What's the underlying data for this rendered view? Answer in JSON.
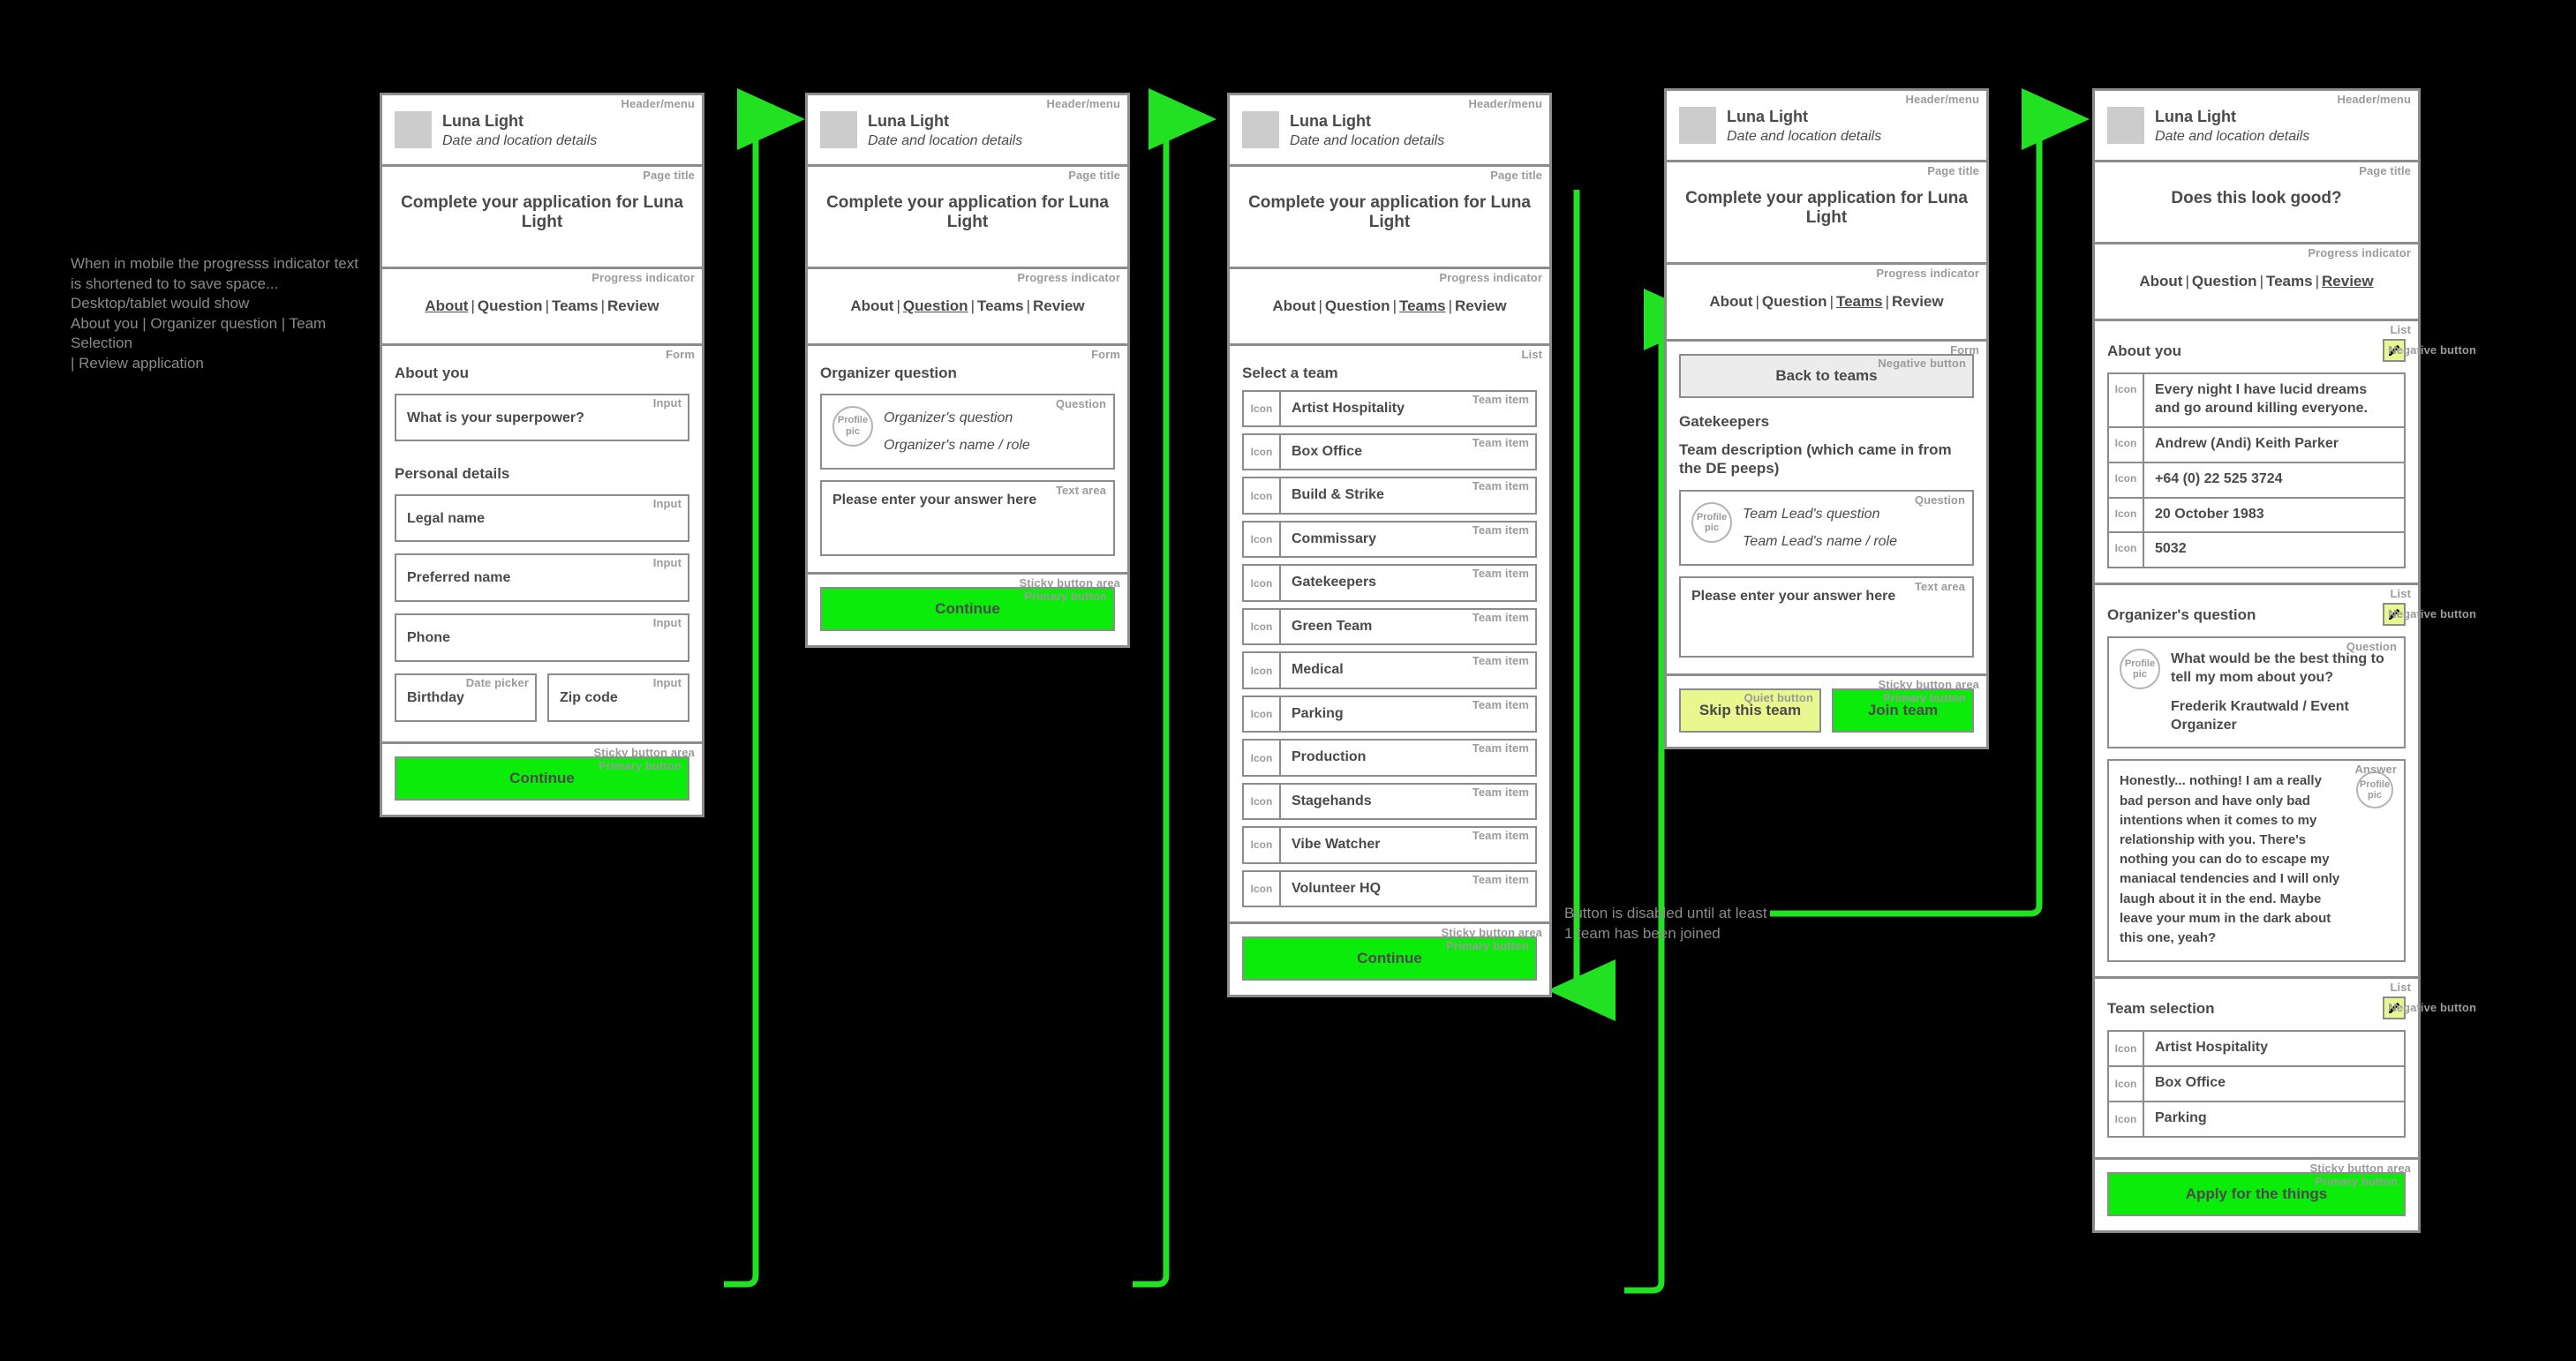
{
  "notes": {
    "progress_note": "When in mobile the progresss indicator text\nis shortened to to save space...\nDesktop/tablet would show\nAbout you | Organizer question | Team Selection\n| Review application",
    "disabled_note": "Button is disabled until at least\n1 team has been joined"
  },
  "labels": {
    "header_menu": "Header/menu",
    "page_title": "Page title",
    "progress_indicator": "Progress indicator",
    "form": "Form",
    "list": "List",
    "input": "Input",
    "date_picker": "Date picker",
    "question": "Question",
    "text_area": "Text area",
    "team_item": "Team item",
    "answer": "Answer",
    "sticky_button_area": "Sticky button area",
    "primary_button": "Primary button",
    "quiet_button": "Quiet button",
    "negative_button": "Negative button",
    "icon": "Icon",
    "profile_pic_line1": "Profile",
    "profile_pic_line2": "pic"
  },
  "header": {
    "event_name": "Luna Light",
    "event_details": "Date and location details"
  },
  "progress": {
    "steps": [
      "About",
      "Question",
      "Teams",
      "Review"
    ],
    "separator": "|"
  },
  "screen1": {
    "page_title": "Complete your application for Luna Light",
    "active_step": "About",
    "section_about_title": "About you",
    "superpower_field": "What is your superpower?",
    "section_personal_title": "Personal details",
    "legal_name": "Legal name",
    "preferred_name": "Preferred name",
    "phone": "Phone",
    "birthday": "Birthday",
    "zip_code": "Zip code",
    "continue": "Continue"
  },
  "screen2": {
    "page_title": "Complete your application for Luna Light",
    "active_step": "Question",
    "section_title": "Organizer question",
    "question_line1": "Organizer's question",
    "question_line2": "Organizer's name / role",
    "answer_placeholder": "Please enter your answer here",
    "continue": "Continue"
  },
  "screen3": {
    "page_title": "Complete your application for Luna Light",
    "active_step": "Teams",
    "section_title": "Select a team",
    "teams": [
      "Artist Hospitality",
      "Box Office",
      "Build & Strike",
      "Commissary",
      "Gatekeepers",
      "Green Team",
      "Medical",
      "Parking",
      "Production",
      "Stagehands",
      "Vibe Watcher",
      "Volunteer HQ"
    ],
    "continue": "Continue"
  },
  "screen4": {
    "page_title": "Complete your application for Luna Light",
    "active_step": "Teams",
    "back_button": "Back to teams",
    "team_name": "Gatekeepers",
    "team_description": "Team description (which came in from the DE peeps)",
    "question_line1": "Team Lead's question",
    "question_line2": "Team Lead's name / role",
    "answer_placeholder": "Please enter your answer here",
    "skip_button": "Skip this team",
    "join_button": "Join team"
  },
  "screen5": {
    "page_title": "Does this look good?",
    "active_step": "Review",
    "about_title": "About you",
    "about_items": [
      "Every night I have lucid dreams and go around killing everyone.",
      "Andrew (Andi) Keith Parker",
      "+64 (0) 22 525 3724",
      "20 October 1983",
      "5032"
    ],
    "organizer_title": "Organizer's question",
    "organizer_question": "What would be the best thing to tell my mom about you?",
    "organizer_name": "Frederik Krautwald / Event Organizer",
    "answer_text": "Honestly... nothing! I am a really bad person and have only bad intentions when it comes to my relationship with you. There's nothing you can do to escape my maniacal tendencies and I will only laugh about it in the end. Maybe leave your mum in the dark about this one, yeah?",
    "team_selection_title": "Team selection",
    "selected_teams": [
      "Artist Hospitality",
      "Box Office",
      "Parking"
    ],
    "apply_button": "Apply for the things"
  },
  "colors": {
    "primary_green": "#0bec0b",
    "quiet_yellow": "#e8f78e",
    "flow_arrow": "#22e022",
    "frame_gray": "#8c8c8c",
    "label_gray": "#9b9b9b"
  }
}
